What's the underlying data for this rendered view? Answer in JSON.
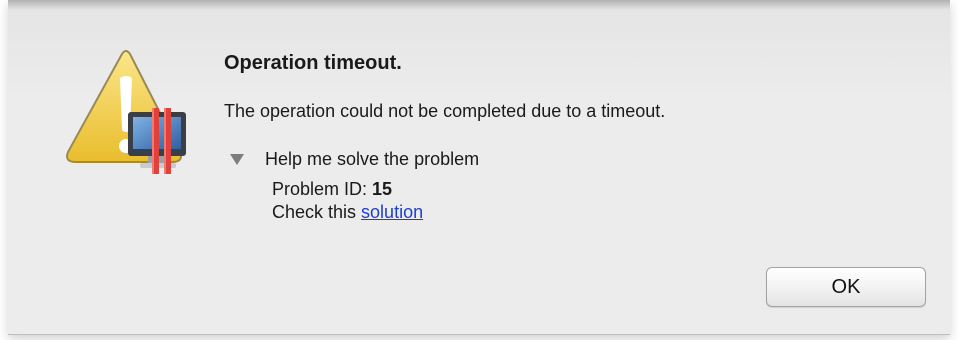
{
  "dialog": {
    "icon": "caution-alert-icon",
    "title": "Operation timeout.",
    "message": "The operation could not be completed due to a timeout.",
    "disclosure": {
      "label": "Help me solve the problem",
      "expanded": true
    },
    "details": {
      "problem_id_label": "Problem ID:",
      "problem_id_value": "15",
      "check_prefix": "Check this",
      "solution_link": "solution"
    },
    "ok_label": "OK"
  },
  "colors": {
    "dialog_background": "#ececec",
    "link": "#1d3fcf",
    "warning_yellow": "#f5d24a",
    "accent_red": "#e0413a"
  }
}
